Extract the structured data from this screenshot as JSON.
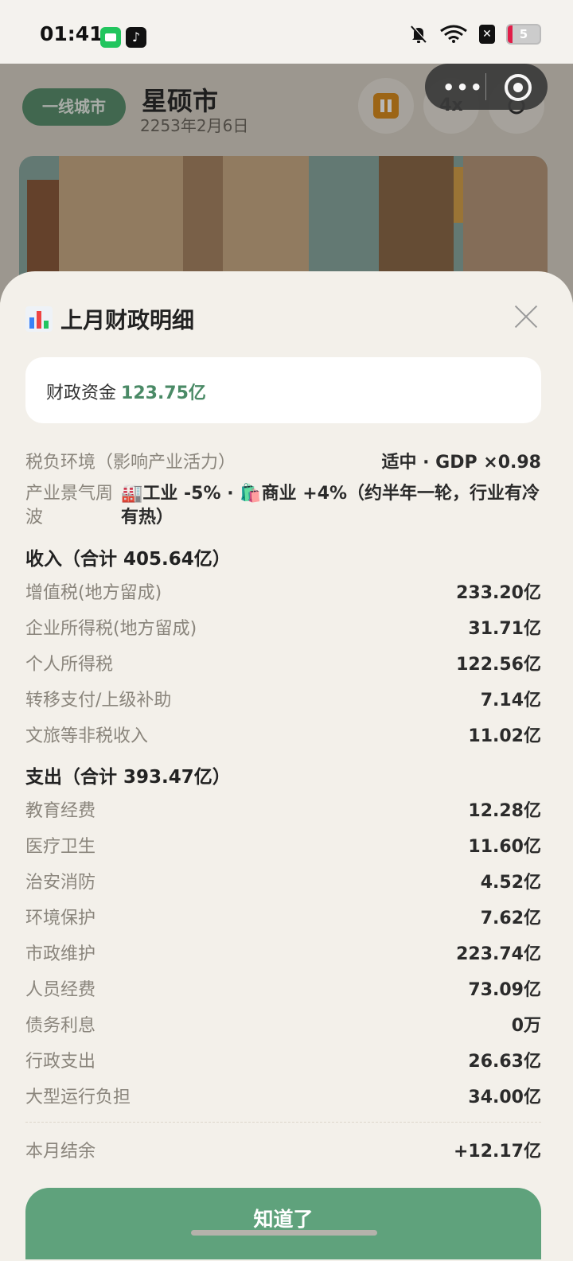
{
  "status_bar": {
    "time": "01:41",
    "tiktok_glyph": "♪",
    "sim_glyph": "✕",
    "battery": "5",
    "icons": [
      "recorder-icon",
      "tiktok-icon",
      "mute-bell-icon",
      "wifi-icon",
      "no-sim-icon",
      "battery-icon"
    ]
  },
  "game": {
    "city_tier": "一线城市",
    "city_name": "星硕市",
    "date": "2253年2月6日",
    "speed": "4x",
    "mini_menu_dots": "•••"
  },
  "sheet": {
    "title_icon": "bar-chart-icon",
    "title": "上月财政明细",
    "fund_label": "财政资金",
    "fund_value": "123.75亿",
    "tax_env_label": "税负环境（影响产业活力）",
    "tax_env_value": "适中 · GDP ×0.98",
    "cycle_label": "产业景气周波",
    "cycle_value": "🏭工业 -5% · 🛍️商业 +4%（约半年一轮，行业有冷有热）",
    "income_header": "收入（合计 405.64亿）",
    "income": [
      {
        "label": "增值税(地方留成)",
        "value": "233.20亿"
      },
      {
        "label": "企业所得税(地方留成)",
        "value": "31.71亿"
      },
      {
        "label": "个人所得税",
        "value": "122.56亿"
      },
      {
        "label": "转移支付/上级补助",
        "value": "7.14亿"
      },
      {
        "label": "文旅等非税收入",
        "value": "11.02亿"
      }
    ],
    "expense_header": "支出（合计 393.47亿）",
    "expense": [
      {
        "label": "教育经费",
        "value": "12.28亿"
      },
      {
        "label": "医疗卫生",
        "value": "11.60亿"
      },
      {
        "label": "治安消防",
        "value": "4.52亿"
      },
      {
        "label": "环境保护",
        "value": "7.62亿"
      },
      {
        "label": "市政维护",
        "value": "223.74亿"
      },
      {
        "label": "人员经费",
        "value": "73.09亿"
      },
      {
        "label": "债务利息",
        "value": "0万"
      },
      {
        "label": "行政支出",
        "value": "26.63亿"
      },
      {
        "label": "大型运行负担",
        "value": "34.00亿"
      }
    ],
    "balance_label": "本月结余",
    "balance_value": "+12.17亿",
    "ok_button": "知道了"
  },
  "colors": {
    "accent_green": "#5fa27c",
    "fund_value_green": "#4a8a66",
    "badge_green": "#5b8f6e",
    "pause_orange": "#d88c1f",
    "background": "#f3f0ea"
  }
}
